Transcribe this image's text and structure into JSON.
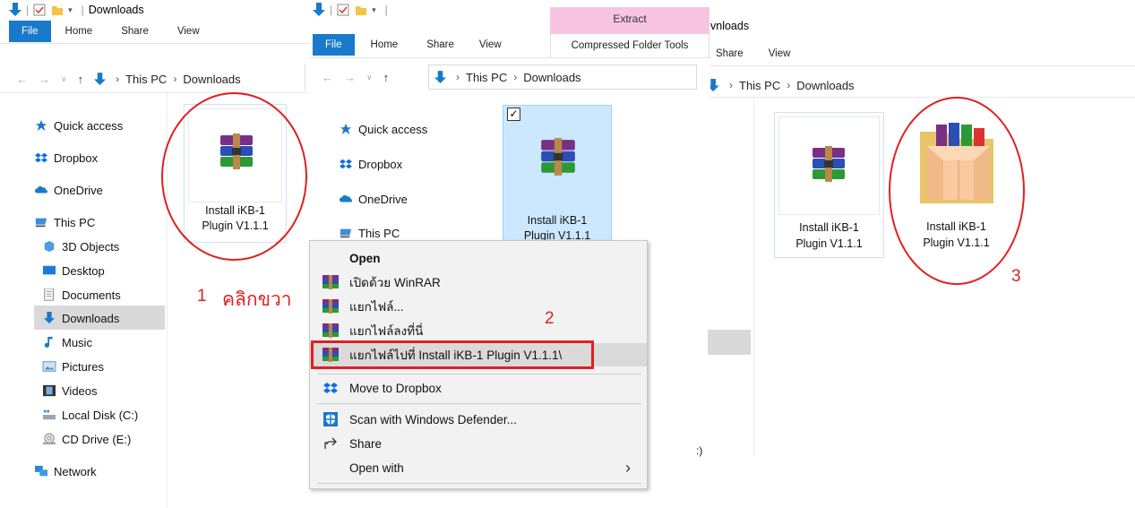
{
  "panel1": {
    "title": "Downloads",
    "tabs": [
      "File",
      "Home",
      "Share",
      "View"
    ],
    "crumbs": [
      "This PC",
      "Downloads"
    ],
    "tree": [
      "Quick access",
      "Dropbox",
      "OneDrive",
      "This PC",
      "3D Objects",
      "Desktop",
      "Documents",
      "Downloads",
      "Music",
      "Pictures",
      "Videos",
      "Local Disk (C:)",
      "CD Drive (E:)",
      "Network"
    ],
    "file_label_1": "Install iKB-1",
    "file_label_2": "Plugin V1.1.1",
    "annotation_num": "1",
    "annotation_text": "คลิกขวา"
  },
  "panel2": {
    "context_tab": "Extract",
    "tabs": [
      "File",
      "Home",
      "Share",
      "View"
    ],
    "context_subtab": "Compressed Folder Tools",
    "crumbs": [
      "This PC",
      "Downloads"
    ],
    "tree": [
      "Quick access",
      "Dropbox",
      "OneDrive",
      "This PC"
    ],
    "file_label_1": "Install iKB-1",
    "file_label_2": "Plugin V1.1.1",
    "drive_fragment": ":)",
    "annotation_num": "2"
  },
  "menu": {
    "items": [
      "Open",
      "เปิดด้วย WinRAR",
      "แยกไฟล์...",
      "แยกไฟล์ลงที่นี่",
      "แยกไฟล์ไปที่ Install iKB-1 Plugin V1.1.1\\",
      "Move to Dropbox",
      "Scan with Windows Defender...",
      "Share",
      "Open with"
    ]
  },
  "panel3": {
    "title_fragment": "vnloads",
    "tabs": [
      "Share",
      "View"
    ],
    "crumbs": [
      "This PC",
      "Downloads"
    ],
    "file1_label_1": "Install iKB-1",
    "file1_label_2": "Plugin V1.1.1",
    "file2_label_1": "Install iKB-1",
    "file2_label_2": "Plugin V1.1.1",
    "annotation_num": "3"
  },
  "colors": {
    "accent": "#1979ca",
    "annotation_red": "#e02020",
    "selection": "#cce8ff",
    "extract_tab": "#f7c5e1"
  }
}
